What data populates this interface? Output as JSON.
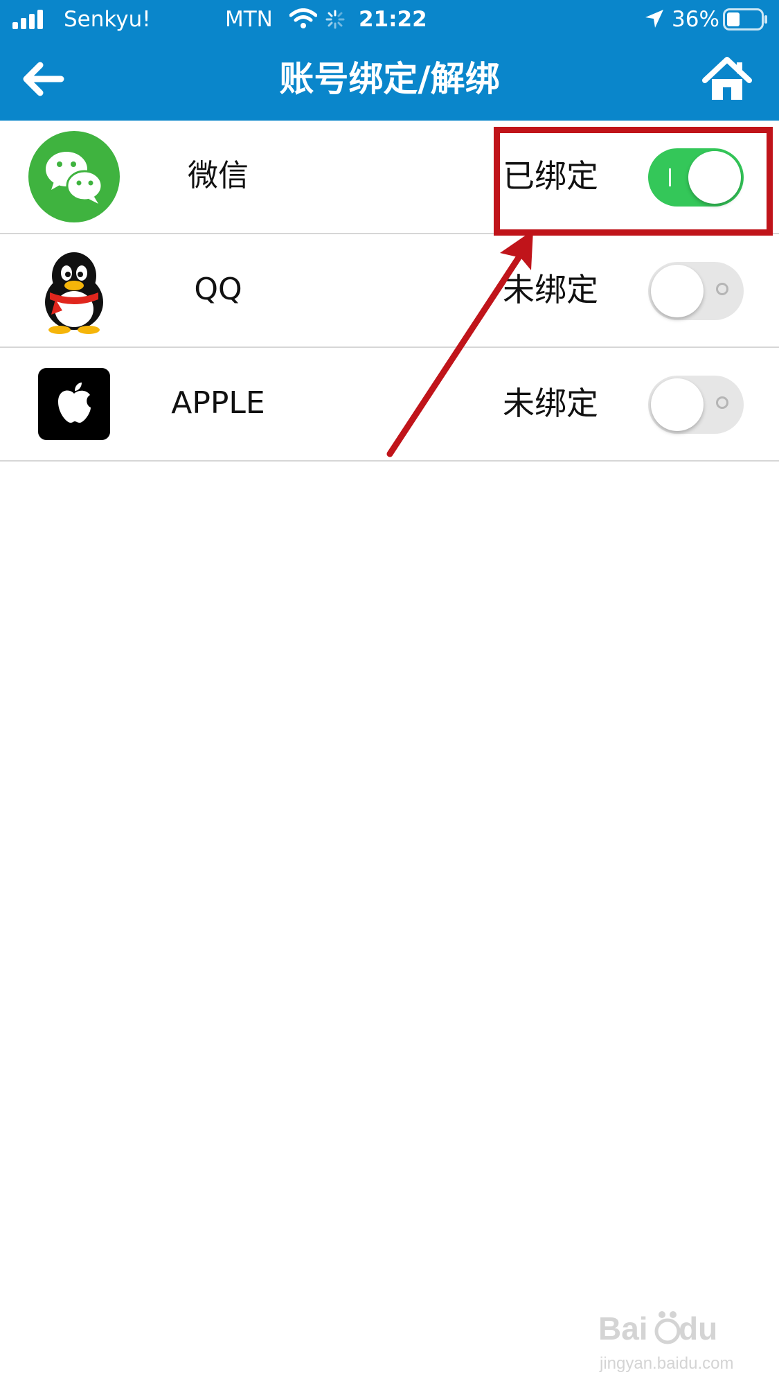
{
  "status_bar": {
    "carrier": "Senkyu!",
    "network": "MTN",
    "time": "21:22",
    "battery": "36%"
  },
  "nav": {
    "title": "账号绑定/解绑",
    "back_icon": "arrow-left-icon",
    "home_icon": "home-icon"
  },
  "accounts": [
    {
      "name": "微信",
      "status": "已绑定",
      "bound": true,
      "icon": "wechat-icon"
    },
    {
      "name": "QQ",
      "status": "未绑定",
      "bound": false,
      "icon": "qq-penguin-icon"
    },
    {
      "name": "APPLE",
      "status": "未绑定",
      "bound": false,
      "icon": "apple-icon"
    }
  ],
  "colors": {
    "header": "#0a86cb",
    "toggle_on": "#34c759",
    "annotation": "#c0141a",
    "wechat": "#3fb33f"
  }
}
